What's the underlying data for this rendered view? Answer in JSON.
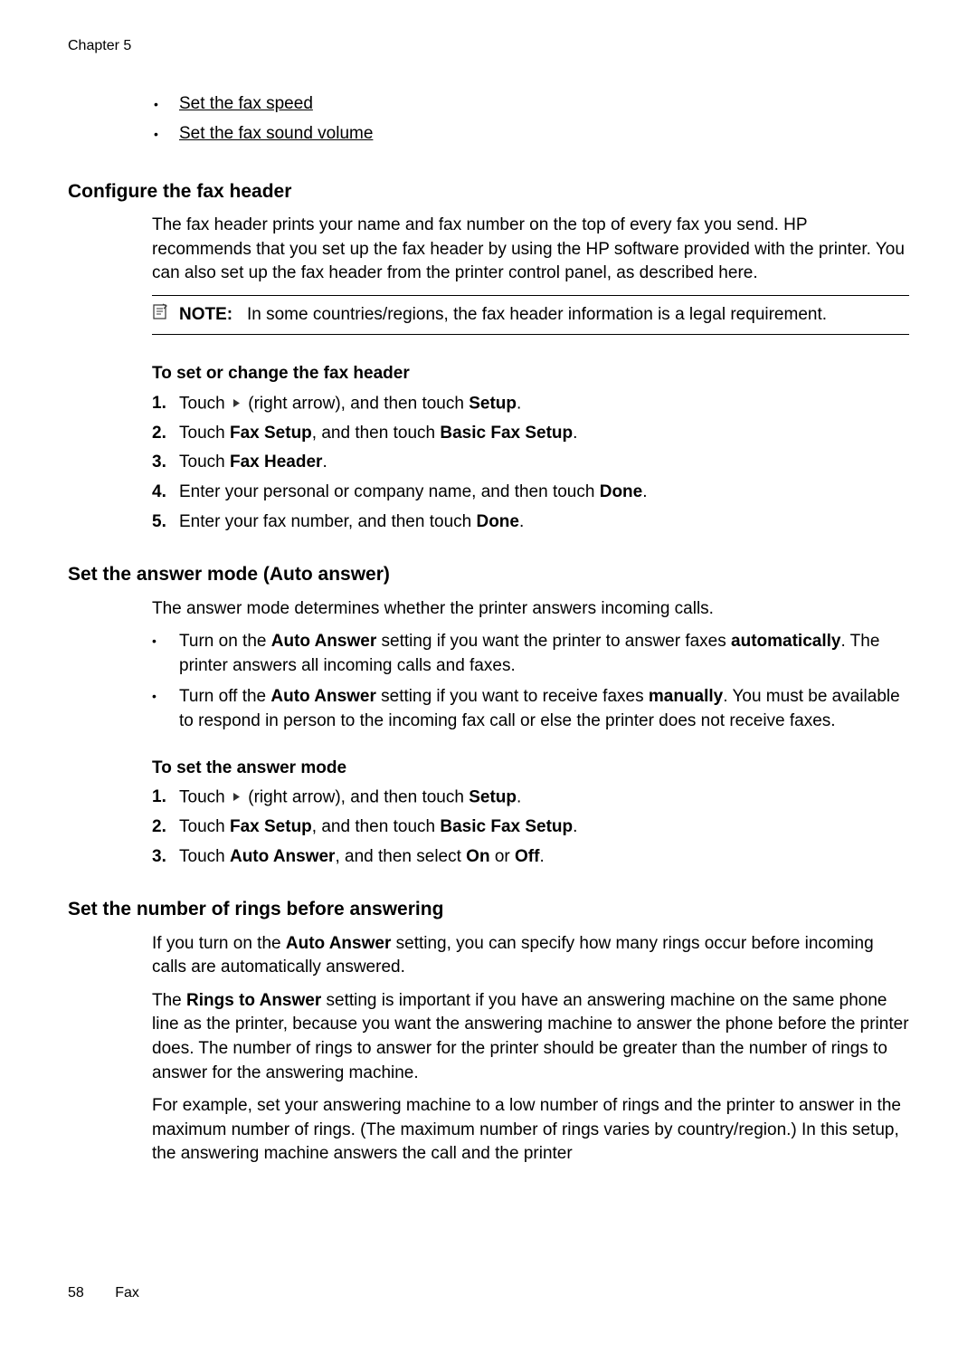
{
  "chapter": "Chapter 5",
  "top_links": [
    "Set the fax speed",
    "Set the fax sound volume"
  ],
  "section1": {
    "heading": "Configure the fax header",
    "intro": "The fax header prints your name and fax number on the top of every fax you send. HP recommends that you set up the fax header by using the HP software provided with the printer. You can also set up the fax header from the printer control panel, as described here.",
    "note_label": "NOTE:",
    "note_text": "In some countries/regions, the fax header information is a legal requirement.",
    "sub_heading": "To set or change the fax header",
    "steps": {
      "s1a": "Touch ",
      "s1b": " (right arrow), and then touch ",
      "s1c": "Setup",
      "s1d": ".",
      "s2a": "Touch ",
      "s2b": "Fax Setup",
      "s2c": ", and then touch ",
      "s2d": "Basic Fax Setup",
      "s2e": ".",
      "s3a": "Touch ",
      "s3b": "Fax Header",
      "s3c": ".",
      "s4a": "Enter your personal or company name, and then touch ",
      "s4b": "Done",
      "s4c": ".",
      "s5a": "Enter your fax number, and then touch ",
      "s5b": "Done",
      "s5c": "."
    }
  },
  "section2": {
    "heading": "Set the answer mode (Auto answer)",
    "intro": "The answer mode determines whether the printer answers incoming calls.",
    "bullets": {
      "b1a": "Turn on the ",
      "b1b": "Auto Answer",
      "b1c": " setting if you want the printer to answer faxes ",
      "b1d": "automatically",
      "b1e": ". The printer answers all incoming calls and faxes.",
      "b2a": "Turn off the ",
      "b2b": "Auto Answer",
      "b2c": " setting if you want to receive faxes ",
      "b2d": "manually",
      "b2e": ". You must be available to respond in person to the incoming fax call or else the printer does not receive faxes."
    },
    "sub_heading": "To set the answer mode",
    "steps": {
      "s1a": "Touch ",
      "s1b": " (right arrow), and then touch ",
      "s1c": "Setup",
      "s1d": ".",
      "s2a": "Touch ",
      "s2b": "Fax Setup",
      "s2c": ", and then touch ",
      "s2d": "Basic Fax Setup",
      "s2e": ".",
      "s3a": "Touch ",
      "s3b": "Auto Answer",
      "s3c": ", and then select ",
      "s3d": "On",
      "s3e": " or ",
      "s3f": "Off",
      "s3g": "."
    }
  },
  "section3": {
    "heading": "Set the number of rings before answering",
    "p1a": "If you turn on the ",
    "p1b": "Auto Answer",
    "p1c": " setting, you can specify how many rings occur before incoming calls are automatically answered.",
    "p2a": "The ",
    "p2b": "Rings to Answer",
    "p2c": " setting is important if you have an answering machine on the same phone line as the printer, because you want the answering machine to answer the phone before the printer does. The number of rings to answer for the printer should be greater than the number of rings to answer for the answering machine.",
    "p3": "For example, set your answering machine to a low number of rings and the printer to answer in the maximum number of rings. (The maximum number of rings varies by country/region.) In this setup, the answering machine answers the call and the printer"
  },
  "footer": {
    "page": "58",
    "section": "Fax"
  },
  "nums": {
    "n1": "1.",
    "n2": "2.",
    "n3": "3.",
    "n4": "4.",
    "n5": "5."
  }
}
